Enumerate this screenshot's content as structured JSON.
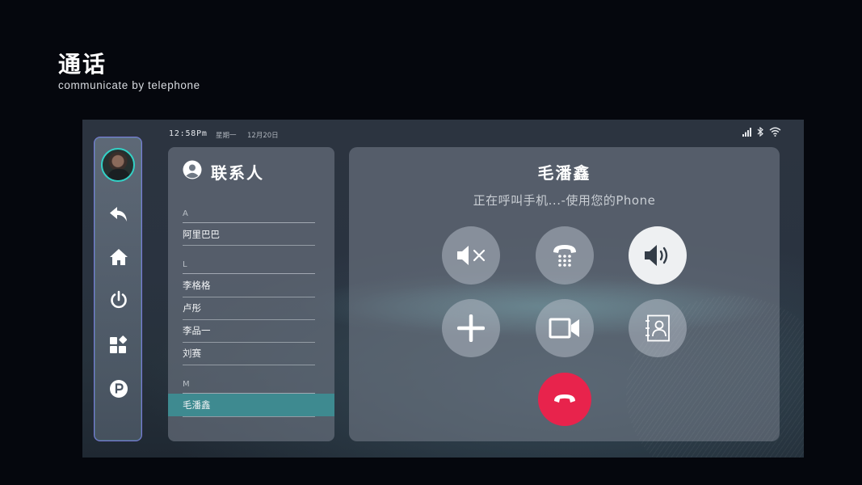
{
  "header": {
    "title": "通话",
    "subtitle": "communicate by telephone"
  },
  "status_bar": {
    "time": "12:58Pm",
    "weekday": "星期一",
    "date": "12月20日",
    "icons": [
      "signal-icon",
      "bluetooth-icon",
      "wifi-icon"
    ]
  },
  "sidebar": {
    "items": [
      "avatar",
      "back-icon",
      "home-icon",
      "power-icon",
      "apps-icon",
      "parking-icon"
    ],
    "border_color": "#7b77d8",
    "avatar_ring_color": "#33d1c6"
  },
  "contacts": {
    "title": "联系人",
    "groups": [
      {
        "letter": "A",
        "names": [
          "阿里巴巴"
        ]
      },
      {
        "letter": "L",
        "names": [
          "李格格",
          "卢彤",
          "李品一",
          "刘赛"
        ]
      },
      {
        "letter": "M",
        "names": [
          "毛潘鑫"
        ]
      }
    ],
    "selected": "毛潘鑫",
    "selected_color": "#3e8a90"
  },
  "call": {
    "name": "毛潘鑫",
    "status": "正在呼叫手机...-使用您的Phone",
    "buttons": [
      {
        "name": "mute",
        "icon": "mute-icon",
        "active": false
      },
      {
        "name": "keypad",
        "icon": "keypad-icon",
        "active": false
      },
      {
        "name": "speaker",
        "icon": "speaker-icon",
        "active": true
      },
      {
        "name": "add-call",
        "icon": "plus-icon",
        "active": false
      },
      {
        "name": "video",
        "icon": "video-icon",
        "active": false
      },
      {
        "name": "contacts",
        "icon": "contact-book-icon",
        "active": false
      }
    ],
    "hangup_icon": "hangup-icon",
    "hangup_color": "#e8234c"
  }
}
